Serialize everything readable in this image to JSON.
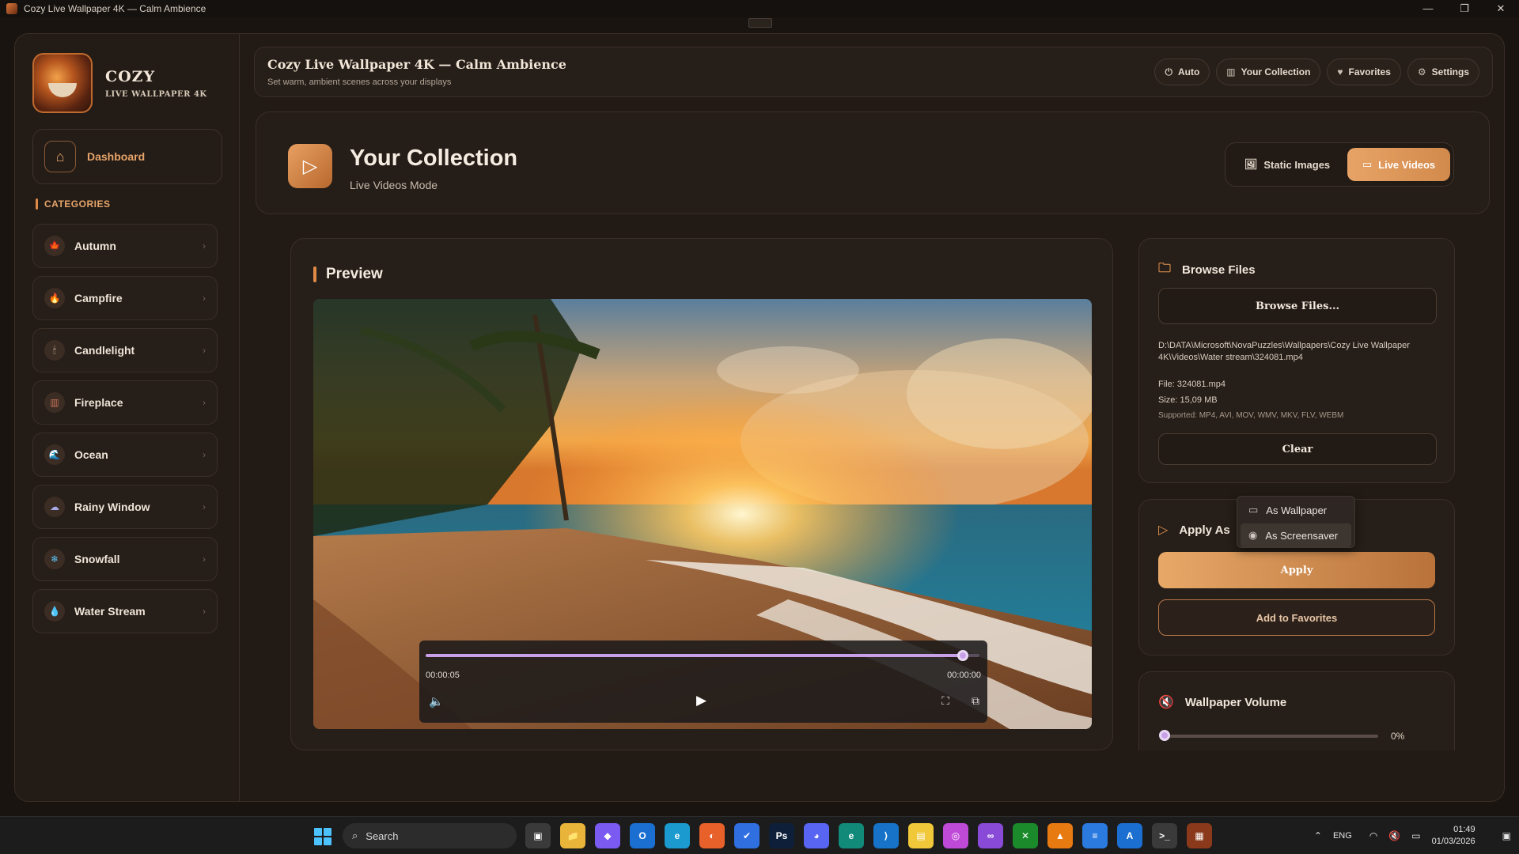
{
  "window": {
    "title": "Cozy Live Wallpaper 4K — Calm Ambience",
    "controls": [
      "—",
      "❐",
      "✕"
    ]
  },
  "brand": {
    "name": "COZY",
    "sub": "LIVE WALLPAPER 4K"
  },
  "sidebar": {
    "dashboard_label": "Dashboard",
    "categories_header": "CATEGORIES",
    "items": [
      {
        "label": "Autumn",
        "icon": "autumn-leaf-icon",
        "glyph": "🍁",
        "color": "#d8553a"
      },
      {
        "label": "Campfire",
        "icon": "campfire-icon",
        "glyph": "🔥",
        "color": "#f0782a"
      },
      {
        "label": "Candlelight",
        "icon": "candle-icon",
        "glyph": "🕯",
        "color": "#f2d9b0"
      },
      {
        "label": "Fireplace",
        "icon": "fireplace-icon",
        "glyph": "▥",
        "color": "#c8765a"
      },
      {
        "label": "Ocean",
        "icon": "ocean-icon",
        "glyph": "🌊",
        "color": "#3c8ad8"
      },
      {
        "label": "Rainy Window",
        "icon": "rain-cloud-icon",
        "glyph": "☁",
        "color": "#a6a8e8"
      },
      {
        "label": "Snowfall",
        "icon": "snowflake-icon",
        "glyph": "❄",
        "color": "#5cc0f0"
      },
      {
        "label": "Water Stream",
        "icon": "water-drop-icon",
        "glyph": "💧",
        "color": "#48a6e8"
      }
    ]
  },
  "header": {
    "title": "Cozy Live Wallpaper 4K — Calm Ambience",
    "subtitle": "Set warm, ambient scenes across your displays",
    "buttons": [
      {
        "label": "Auto",
        "icon": "power-icon",
        "glyph": "⏻"
      },
      {
        "label": "Your Collection",
        "icon": "library-icon",
        "glyph": "▥"
      },
      {
        "label": "Favorites",
        "icon": "heart-icon",
        "glyph": "♥"
      },
      {
        "label": "Settings",
        "icon": "gear-icon",
        "glyph": "⚙"
      }
    ]
  },
  "collection": {
    "title": "Your Collection",
    "subtitle": "Live Videos Mode",
    "modes": {
      "static_label": "Static Images",
      "live_label": "Live Videos",
      "active": "Live Videos"
    }
  },
  "preview": {
    "title": "Preview",
    "time_current": "00:00:05",
    "time_total": "00:00:00",
    "progress": 0.97
  },
  "browse": {
    "title": "Browse Files",
    "button_label": "Browse Files...",
    "path": "D:\\DATA\\Microsoft\\NovaPuzzles\\Wallpapers\\Cozy Live Wallpaper 4K\\Videos\\Water stream\\324081.mp4",
    "file": "File: 324081.mp4",
    "size": "Size: 15,09 MB",
    "supported": "Supported: MP4, AVI, MOV, WMV, MKV, FLV, WEBM",
    "clear_label": "Clear"
  },
  "apply": {
    "title": "Apply As",
    "apply_label": "Apply",
    "favorites_label": "Add to Favorites",
    "options": [
      {
        "label": "As Wallpaper",
        "icon": "monitor-icon",
        "glyph": "▭"
      },
      {
        "label": "As Screensaver",
        "icon": "eye-icon",
        "glyph": "◉"
      }
    ],
    "highlighted": "As Screensaver"
  },
  "volume": {
    "title": "Wallpaper Volume",
    "value_label": "0%",
    "level": 0
  },
  "taskbar": {
    "search_placeholder": "Search",
    "apps": [
      {
        "name": "task-view-icon",
        "glyph": "▣",
        "bg": "#3a3a3a"
      },
      {
        "name": "file-explorer-icon",
        "glyph": "📁",
        "bg": "#e9b43a"
      },
      {
        "name": "copilot-icon",
        "glyph": "◆",
        "bg": "#7a5af0"
      },
      {
        "name": "outlook-icon",
        "glyph": "O",
        "bg": "#1a6fd0"
      },
      {
        "name": "edge-icon",
        "glyph": "e",
        "bg": "#1b9ad0"
      },
      {
        "name": "firefox-icon",
        "glyph": "◐",
        "bg": "#e8602a"
      },
      {
        "name": "todo-icon",
        "glyph": "✔",
        "bg": "#2f6fe0"
      },
      {
        "name": "photoshop-icon",
        "glyph": "Ps",
        "bg": "#0e1f3a"
      },
      {
        "name": "discord-icon",
        "glyph": "◕",
        "bg": "#5865f2"
      },
      {
        "name": "edge-dev-icon",
        "glyph": "e",
        "bg": "#128a7a"
      },
      {
        "name": "vscode-icon",
        "glyph": "⟩",
        "bg": "#1673c8"
      },
      {
        "name": "sticky-notes-icon",
        "glyph": "▤",
        "bg": "#f0c83a"
      },
      {
        "name": "clipchamp-icon",
        "glyph": "◎",
        "bg": "#c04ad8"
      },
      {
        "name": "visual-studio-icon",
        "glyph": "∞",
        "bg": "#8a4ad8"
      },
      {
        "name": "xbox-icon",
        "glyph": "✕",
        "bg": "#1a8a2a"
      },
      {
        "name": "vlc-icon",
        "glyph": "▲",
        "bg": "#e87a12"
      },
      {
        "name": "notepad-icon",
        "glyph": "≡",
        "bg": "#2a7ae0"
      },
      {
        "name": "azure-icon",
        "glyph": "A",
        "bg": "#1a6fd0"
      },
      {
        "name": "terminal-icon",
        "glyph": ">_",
        "bg": "#3a3a3a"
      },
      {
        "name": "cozy-app-icon",
        "glyph": "▦",
        "bg": "#8a3a1a"
      }
    ],
    "language": "ENG",
    "time": "01:49",
    "date": "01/03/2026"
  }
}
